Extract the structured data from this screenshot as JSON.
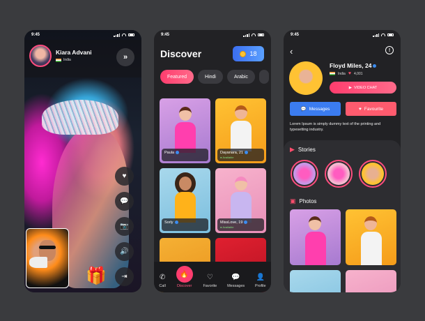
{
  "status_time": "9:45",
  "call_screen": {
    "caller_name": "Kiara Advani",
    "caller_location": "India",
    "next_icon": "double-chevron-right-icon",
    "actions": [
      "heart-icon",
      "chat-icon",
      "camera-switch-icon",
      "volume-icon",
      "exit-icon"
    ],
    "gift_icon": "gift-icon"
  },
  "discover": {
    "title": "Discover",
    "coins": "18",
    "filters": [
      "Featured",
      "Hindi",
      "Arabic"
    ],
    "cards": [
      {
        "name": "Paula",
        "status": ""
      },
      {
        "name": "Dayanara, 21",
        "status": "Available"
      },
      {
        "name": "Sorly",
        "status": ""
      },
      {
        "name": "MissLove, 19",
        "status": "Available"
      }
    ],
    "nav": [
      {
        "label": "Call",
        "icon": "phone-icon"
      },
      {
        "label": "Discover",
        "icon": "flame-icon"
      },
      {
        "label": "Favorite",
        "icon": "heart-icon"
      },
      {
        "label": "Messages",
        "icon": "chat-icon"
      },
      {
        "label": "Profile",
        "icon": "user-icon"
      }
    ],
    "active_nav": "Discover"
  },
  "profile": {
    "name": "Floyd Miles, 24",
    "location": "India",
    "likes": "4,001",
    "video_chat_label": "VIDEO CHAT",
    "messages_label": "Messages",
    "favourite_label": "Favourite",
    "bio": "Lorem Ipsum is simply dummy text of the printing and typesetting industry.",
    "stories_label": "Stories",
    "photos_label": "Photos"
  },
  "colors": {
    "accent": "#ff3d6e",
    "blue": "#3b7cf0",
    "background": "#3a3b3e",
    "panel": "#222225"
  }
}
